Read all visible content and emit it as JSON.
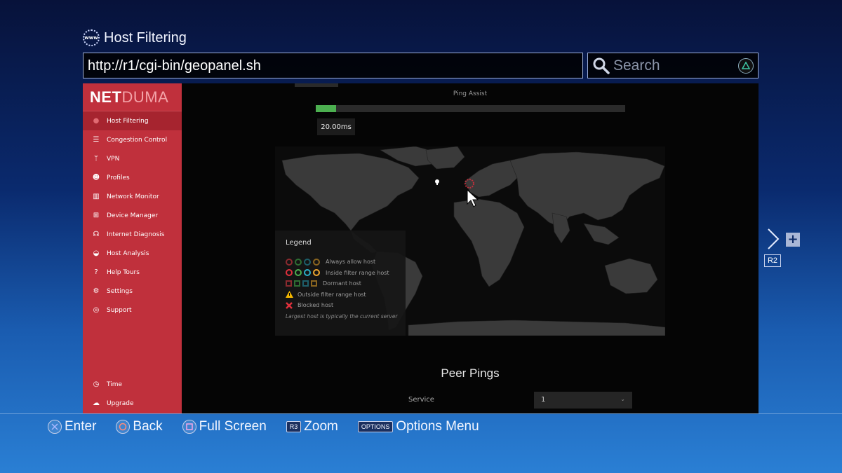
{
  "browser": {
    "page_title": "Host Filtering",
    "url": "http://r1/cgi-bin/geopanel.sh",
    "search_placeholder": "Search"
  },
  "sidebar": {
    "logo_part1": "NET",
    "logo_part2": "DUMA",
    "items": [
      {
        "label": "Host Filtering",
        "icon": "globe-icon",
        "active": true
      },
      {
        "label": "Congestion Control",
        "icon": "sliders-icon"
      },
      {
        "label": "VPN",
        "icon": "branch-icon"
      },
      {
        "label": "Profiles",
        "icon": "users-icon"
      },
      {
        "label": "Network Monitor",
        "icon": "bar-chart-icon"
      },
      {
        "label": "Device Manager",
        "icon": "sitemap-icon"
      },
      {
        "label": "Internet Diagnosis",
        "icon": "stethoscope-icon"
      },
      {
        "label": "Host Analysis",
        "icon": "dashboard-icon"
      },
      {
        "label": "Help Tours",
        "icon": "question-icon"
      },
      {
        "label": "Settings",
        "icon": "gears-icon"
      },
      {
        "label": "Support",
        "icon": "lifebuoy-icon"
      }
    ],
    "bottom_items": [
      {
        "label": "Time",
        "icon": "clock-icon"
      },
      {
        "label": "Upgrade",
        "icon": "cloud-download-icon"
      }
    ]
  },
  "main": {
    "ping_assist_label": "Ping Assist",
    "ping_assist_fraction": 0.065,
    "ping_value": "20.00ms",
    "legend": {
      "title": "Legend",
      "rows": [
        {
          "label": "Always allow host",
          "kind": "ring-dim"
        },
        {
          "label": "Inside filter range host",
          "kind": "ring-bright"
        },
        {
          "label": "Dormant host",
          "kind": "square"
        },
        {
          "label": "Outside filter range host",
          "kind": "warning"
        },
        {
          "label": "Blocked host",
          "kind": "cross"
        }
      ],
      "note": "Largest host is typically the current server"
    },
    "peer_pings_title": "Peer Pings",
    "service_label": "Service",
    "service_value": "1"
  },
  "colors": {
    "sidebar": "#c0303c",
    "active_item": "#a6242f",
    "ping_fill": "#4caf50",
    "legend_ring": [
      "#c0303c",
      "#4caf50",
      "#2196a8",
      "#e0a030"
    ]
  },
  "side_nav": {
    "r2_label": "R2"
  },
  "bottom_bar": {
    "enter": "Enter",
    "back": "Back",
    "full_screen": "Full Screen",
    "r3": "R3",
    "zoom": "Zoom",
    "options_btn": "OPTIONS",
    "options_menu": "Options Menu"
  }
}
